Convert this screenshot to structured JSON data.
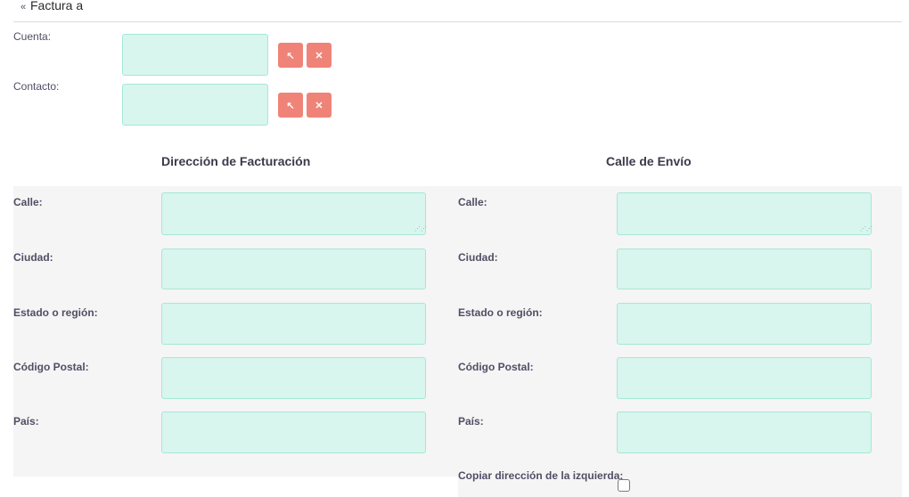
{
  "panel": {
    "title": "Factura a",
    "chevron": "«"
  },
  "account": {
    "label": "Cuenta:",
    "value": "",
    "select_icon": "↖",
    "clear_icon": "✕"
  },
  "contact": {
    "label": "Contacto:",
    "value": "",
    "select_icon": "↖",
    "clear_icon": "✕"
  },
  "billing": {
    "heading": "Dirección de Facturación",
    "street_label": "Calle:",
    "city_label": "Ciudad:",
    "state_label": "Estado o región:",
    "postal_label": "Código Postal:",
    "country_label": "País:",
    "street": "",
    "city": "",
    "state": "",
    "postal": "",
    "country": ""
  },
  "shipping": {
    "heading": "Calle de Envío",
    "street_label": "Calle:",
    "city_label": "Ciudad:",
    "state_label": "Estado o región:",
    "postal_label": "Código Postal:",
    "country_label": "País:",
    "street": "",
    "city": "",
    "state": "",
    "postal": "",
    "country": "",
    "copy_label": "Copiar dirección de la izquierda:",
    "copy_checked": false
  },
  "colors": {
    "field_bg": "#d8f5ee",
    "field_border": "#a5e8d6",
    "button": "#f08377",
    "section_bg": "#f5f5f5"
  }
}
